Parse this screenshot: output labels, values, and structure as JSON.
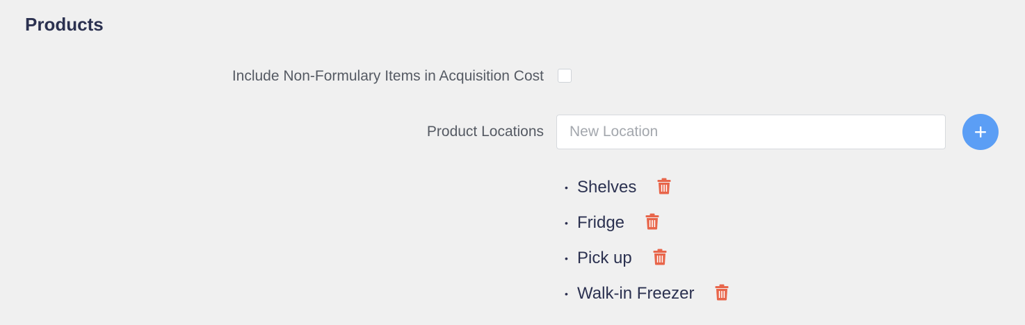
{
  "section": {
    "title": "Products"
  },
  "settings": {
    "nonformulary_label": "Include Non-Formulary Items in Acquisition Cost",
    "nonformulary_checked": false,
    "locations_label": "Product Locations",
    "location_input_value": "",
    "location_input_placeholder": "New Location",
    "add_icon": "plus-icon",
    "delete_icon": "trash-icon"
  },
  "locations": [
    {
      "name": "Shelves",
      "bullet": "•"
    },
    {
      "name": "Fridge",
      "bullet": "•"
    },
    {
      "name": "Pick up",
      "bullet": "•"
    },
    {
      "name": "Walk-in Freezer",
      "bullet": "•"
    }
  ],
  "colors": {
    "background": "#f0f0f0",
    "title": "#2b3150",
    "label": "#555a63",
    "accent_blue": "#5b9ef5",
    "delete_red": "#e8654a"
  }
}
